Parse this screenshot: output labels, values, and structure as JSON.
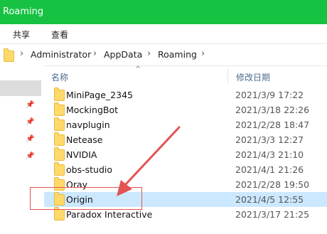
{
  "window": {
    "title": "Roaming"
  },
  "ribbon": {
    "tabs": [
      "共享",
      "查看"
    ]
  },
  "address": {
    "crumbs": [
      "Administrator",
      "AppData",
      "Roaming"
    ]
  },
  "columns": {
    "name": "名称",
    "date": "修改日期"
  },
  "files": [
    {
      "name": "MiniPage_2345",
      "date": "2021/3/9 17:22",
      "selected": false
    },
    {
      "name": "MockingBot",
      "date": "2021/3/18 22:26",
      "selected": false
    },
    {
      "name": "navplugin",
      "date": "2021/2/28 18:47",
      "selected": false
    },
    {
      "name": "Netease",
      "date": "2021/3/3 12:27",
      "selected": false
    },
    {
      "name": "NVIDIA",
      "date": "2021/4/3 21:10",
      "selected": false
    },
    {
      "name": "obs-studio",
      "date": "2021/4/1 21:26",
      "selected": false
    },
    {
      "name": "Oray",
      "date": "2021/2/28 19:50",
      "selected": false
    },
    {
      "name": "Origin",
      "date": "2021/4/5 12:55",
      "selected": true
    },
    {
      "name": "Paradox Interactive",
      "date": "2021/3/17 21:25",
      "selected": false
    }
  ],
  "colors": {
    "titlebar": "#17c242",
    "selection": "#cce8ff",
    "annotation": "#e35353",
    "folder": "#ffd96a"
  },
  "icons": [
    "folder-icon",
    "chevron-right-icon",
    "pin-icon",
    "sort-up-icon"
  ]
}
